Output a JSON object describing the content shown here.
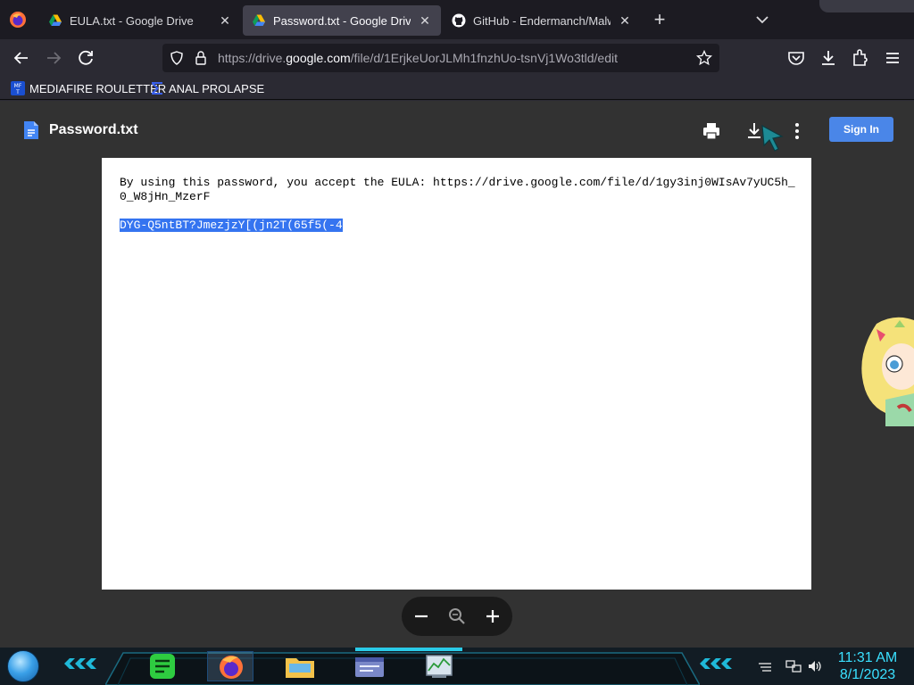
{
  "browser": {
    "tabs": [
      {
        "title": "EULA.txt - Google Drive",
        "icon": "google-drive-icon",
        "active": false
      },
      {
        "title": "Password.txt - Google Drive",
        "icon": "google-drive-icon",
        "active": true
      },
      {
        "title": "GitHub - Endermanch/Malwar",
        "icon": "github-icon",
        "active": false
      }
    ],
    "new_tab_label": "+",
    "tab_close_glyph": "✕",
    "url_prefix": "https://drive.",
    "url_domain": "google.com",
    "url_path": "/file/d/1ErjkeUorJLMh1fnzhUo-tsnVj1Wo3tld/edit",
    "bookmarks": [
      {
        "label": "MEDIAFIRE ROULETTER",
        "icon": "mediafire-icon"
      },
      {
        "label": "ANAL PROLAPSE",
        "icon": "sigma-icon"
      }
    ]
  },
  "drive": {
    "file_name": "Password.txt",
    "sign_in_label": "Sign In",
    "document": {
      "line1": "By using this password, you accept the EULA: https://drive.google.com/file/d/1gy3inj0WIsAv7yUC5h_0_W8jHn_MzerF",
      "selected_text": "DYG-Q5ntBT?JmezjzY[(jn2T(65f5(-4"
    }
  },
  "taskbar": {
    "apps": [
      "notes-app-icon",
      "firefox-icon",
      "file-explorer-icon",
      "control-panel-icon",
      "task-manager-icon"
    ],
    "time": "11:31 AM",
    "date": "8/1/2023"
  },
  "colors": {
    "accent": "#4a86e8",
    "selection": "#3574f0",
    "clock": "#3ae0ff",
    "viewer_bg": "#323232"
  }
}
